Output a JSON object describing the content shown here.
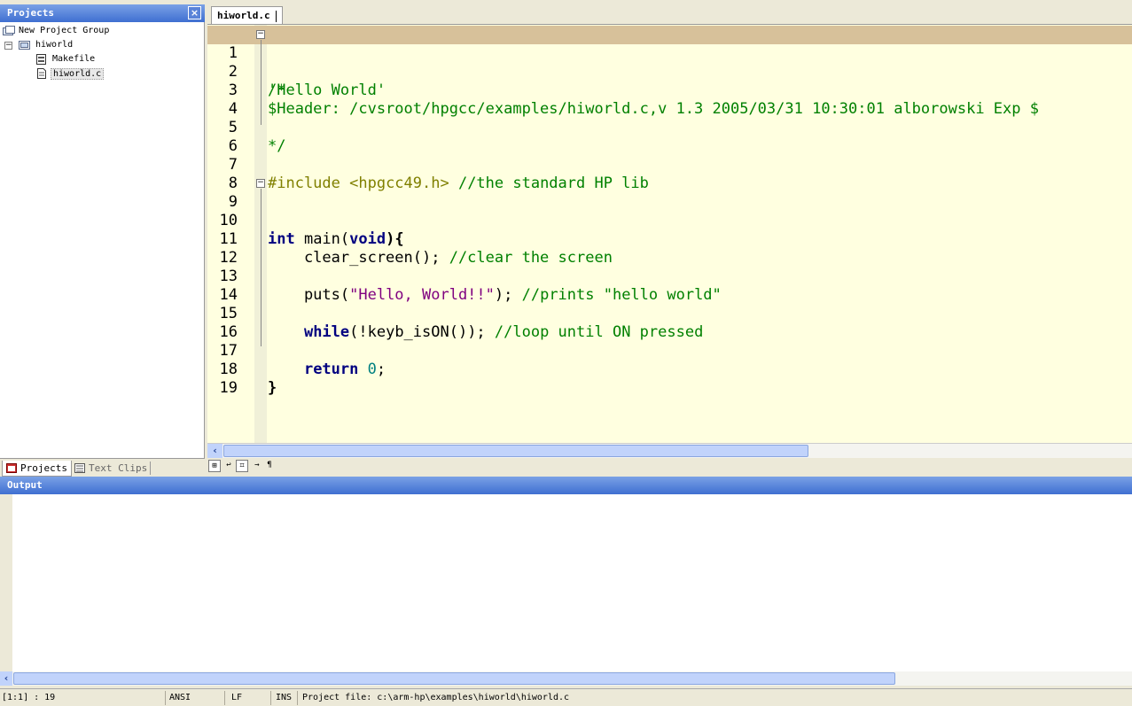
{
  "projects_panel": {
    "title": "Projects",
    "close": "×",
    "tree": {
      "group": "New Project Group",
      "project": "hiworld",
      "files": [
        "Makefile",
        "hiworld.c"
      ]
    },
    "tabs": [
      "Projects",
      "Text Clips"
    ]
  },
  "editor": {
    "tab": "hiworld.c",
    "line_numbers": [
      "1",
      "2",
      "3",
      "4",
      "5",
      "6",
      "7",
      "8",
      "9",
      "10",
      "11",
      "12",
      "13",
      "14",
      "15",
      "16",
      "17",
      "18",
      "19"
    ],
    "lines": {
      "l1": "/*",
      "l2": "'Hello World'",
      "l3": "$Header: /cvsroot/hpgcc/examples/hiworld.c,v 1.3 2005/03/31 10:30:01 alborowski Exp $",
      "l5": "*/",
      "l7_pre": "#include ",
      "l7_hdr": "<hpgcc49.h>",
      "l7_com": " //the standard HP lib",
      "l9_kw": "int",
      "l9_mid": " main(",
      "l9_kw2": "void",
      "l9_end": "){",
      "l11_code": "    clear_screen(); ",
      "l11_com": "//clear the screen",
      "l13_code": "    puts(",
      "l13_str": "\"Hello, World!!\"",
      "l13_end": "); ",
      "l13_com": "//prints \"hello world\"",
      "l15_kw": "while",
      "l15_code": "(!keyb_isON()); ",
      "l15_com": "//loop until ON pressed",
      "l17_kw": "return",
      "l17_num": "0",
      "l17_end": ";",
      "l18": "}"
    },
    "toolbar": [
      "⊞",
      "↩",
      "⌗",
      "→",
      "¶"
    ]
  },
  "output": {
    "title": "Output"
  },
  "status_bar": {
    "position": "[1:1] : 19",
    "encoding": "ANSI",
    "line_ending": "LF",
    "mode": "INS",
    "project_file": "Project file: c:\\arm-hp\\examples\\hiworld\\hiworld.c"
  },
  "colors": {
    "titlebar": "#3f6fd1",
    "editor_bg": "#ffffe0",
    "current_line": "#d7c19a",
    "comment": "#008000",
    "keyword": "#000080",
    "string": "#800080"
  }
}
